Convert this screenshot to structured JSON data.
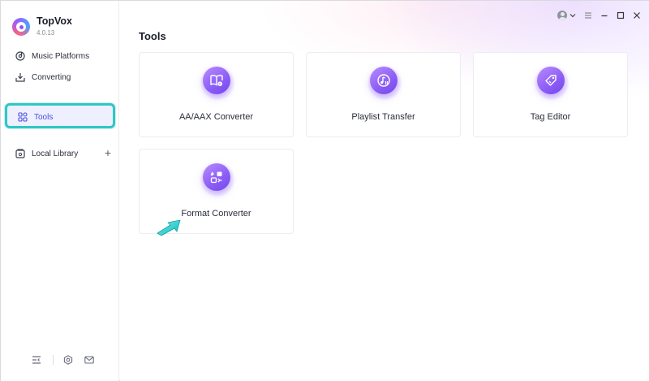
{
  "app": {
    "name": "TopVox",
    "version": "4.0.13"
  },
  "sidebar": {
    "items": [
      {
        "label": "Music Platforms",
        "icon": "music-disc-icon"
      },
      {
        "label": "Converting",
        "icon": "download-tray-icon"
      },
      {
        "label": "Tools",
        "icon": "grid-icon",
        "active": true
      },
      {
        "label": "Local Library",
        "icon": "library-icon"
      }
    ],
    "add_symbol": "+",
    "bottom_icons": [
      "collapse-sidebar-icon",
      "settings-hex-icon",
      "mail-icon"
    ]
  },
  "main": {
    "title": "Tools",
    "tools": [
      {
        "label": "AA/AAX Converter",
        "icon": "audiobook-icon"
      },
      {
        "label": "Playlist Transfer",
        "icon": "playlist-music-icon"
      },
      {
        "label": "Tag Editor",
        "icon": "tag-icon"
      },
      {
        "label": "Format Converter",
        "icon": "format-swap-icon"
      }
    ]
  },
  "titlebar": {
    "icons": [
      "user-avatar-icon",
      "chevron-down-icon",
      "menu-icon",
      "minimize-icon",
      "maximize-icon",
      "close-icon"
    ]
  },
  "colors": {
    "accent": "#8b5cf6",
    "highlight": "#2fc7c6",
    "active_text": "#4b4fd8"
  }
}
